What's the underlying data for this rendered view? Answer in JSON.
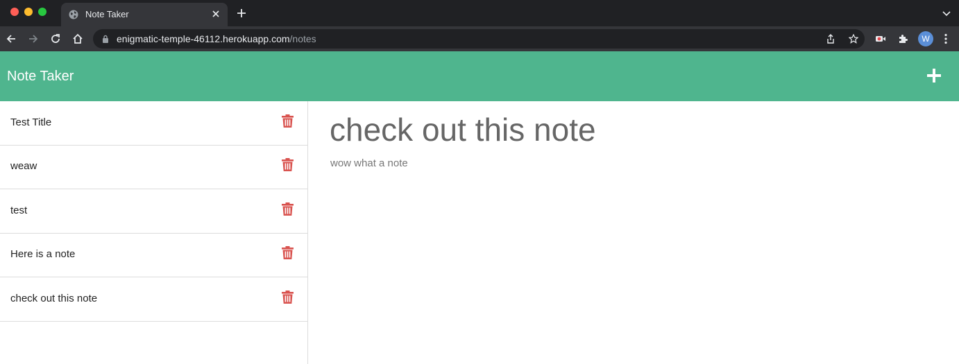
{
  "browser": {
    "tab_title": "Note Taker",
    "url_host": "enigmatic-temple-46112.herokuapp.com",
    "url_path": "/notes",
    "profile_initial": "W"
  },
  "app": {
    "title": "Note Taker",
    "accent_color": "#4fb58e",
    "delete_color": "#d9534f"
  },
  "notes": [
    {
      "title": "Test Title"
    },
    {
      "title": "weaw"
    },
    {
      "title": "test"
    },
    {
      "title": "Here is a note"
    },
    {
      "title": "check out this note"
    }
  ],
  "active_note": {
    "title": "check out this note",
    "text": "wow what a note"
  }
}
